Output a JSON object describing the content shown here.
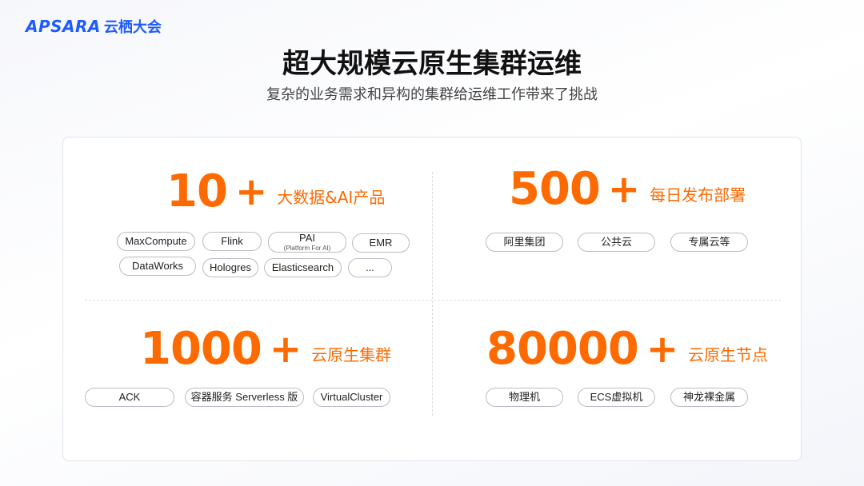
{
  "brand": {
    "mark": "APSARA",
    "name": "云栖大会"
  },
  "header": {
    "title": "超大规模云原生集群运维",
    "subtitle": "复杂的业务需求和异构的集群给运维工作带来了挑战"
  },
  "quadrants": [
    {
      "number": "10",
      "plus": "+",
      "label": "大数据&AI产品",
      "tags": [
        "MaxCompute",
        "Flink",
        "PAI",
        "EMR",
        "DataWorks",
        "Hologres",
        "Elasticsearch",
        "..."
      ],
      "tag_note": "(Platform For AI)"
    },
    {
      "number": "500",
      "plus": "+",
      "label": "每日发布部署",
      "tags": [
        "阿里集团",
        "公共云",
        "专属云等"
      ]
    },
    {
      "number": "1000",
      "plus": "+",
      "label": "云原生集群",
      "tags": [
        "ACK",
        "容器服务 Serverless 版",
        "VirtualCluster"
      ]
    },
    {
      "number": "80000",
      "plus": "+",
      "label": "云原生节点",
      "tags": [
        "物理机",
        "ECS虚拟机",
        "神龙裸金属"
      ]
    }
  ],
  "colors": {
    "accent": "#ff6a00",
    "brand": "#1e5bff"
  }
}
